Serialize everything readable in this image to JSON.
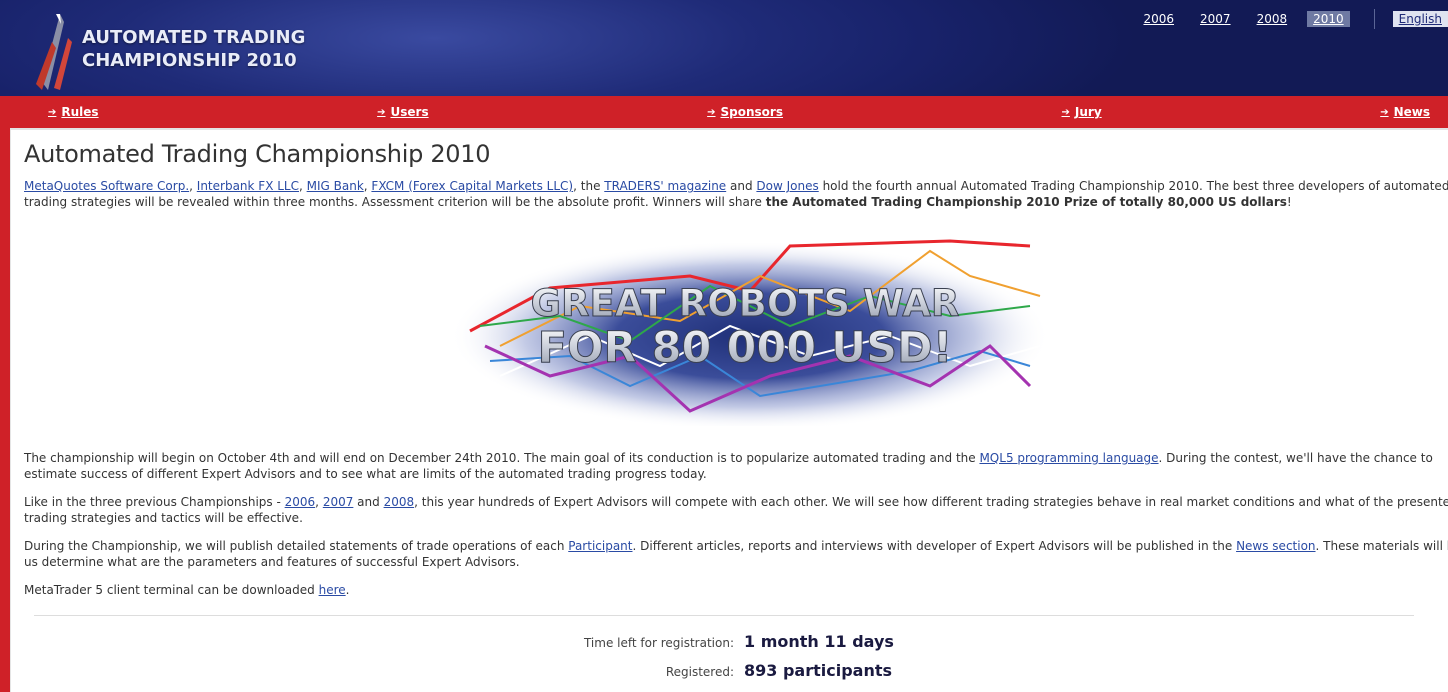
{
  "header": {
    "logo_line1": "AUTOMATED TRADING",
    "logo_line2": "CHAMPIONSHIP 2010",
    "years": [
      "2006",
      "2007",
      "2008",
      "2010"
    ],
    "active_year": "2010",
    "language": "English"
  },
  "nav": {
    "items": [
      "Rules",
      "Users",
      "Sponsors",
      "Jury",
      "News"
    ]
  },
  "main": {
    "title": "Automated Trading Championship 2010",
    "intro": {
      "links": [
        "MetaQuotes Software Corp.",
        "Interbank FX LLC",
        "MIG Bank",
        "FXCM (Forex Capital Markets LLC)",
        "TRADERS' magazine",
        "Dow Jones"
      ],
      "sep1": ", ",
      "the": ", the ",
      "and": " and ",
      "text1": " hold the fourth annual Automated Trading Championship 2010. The best three developers of automated trading strategies will be revealed within three months. Assessment criterion will be the absolute profit. Winners will share ",
      "bold": "the Automated Trading Championship 2010 Prize of totally 80,000 US dollars",
      "end": "!"
    },
    "banner": {
      "line1": "GREAT ROBOTS WAR",
      "line2": "FOR 80 000 USD!"
    },
    "para2": {
      "text1": "The championship will begin on October 4th and will end on December 24th 2010. The main goal of its conduction is to popularize automated trading and the ",
      "link": "MQL5 programming language",
      "text2": ". During the contest, we'll have the chance to estimate success of different Expert Advisors and to see what are limits of the automated trading progress today."
    },
    "para3": {
      "text1": "Like in the three previous Championships - ",
      "links": [
        "2006",
        "2007",
        "2008"
      ],
      "comma": ", ",
      "and": " and ",
      "text2": ", this year hundreds of Expert Advisors will compete with each other. We will see how different trading strategies behave in real market conditions and what of the presented trading strategies and tactics will be effective."
    },
    "para4": {
      "text1": "During the Championship, we will publish detailed statements of trade operations of each ",
      "link1": "Participant",
      "text2": ". Different articles, reports and interviews with developer of Expert Advisors will be published in the ",
      "link2": "News section",
      "text3": ". These materials will help us determine what are the parameters and features of successful Expert Advisors."
    },
    "para5": {
      "text1": "MetaTrader 5 client terminal can be downloaded ",
      "link": "here",
      "text2": "."
    },
    "stats": {
      "time_label": "Time left for registration:",
      "time_value": "1 month 11 days",
      "reg_label": "Registered:",
      "reg_value": "893 participants"
    }
  },
  "colors": {
    "header_blue": "#1f2b78",
    "nav_red": "#cf2128",
    "link_blue": "#2a4ba4"
  }
}
